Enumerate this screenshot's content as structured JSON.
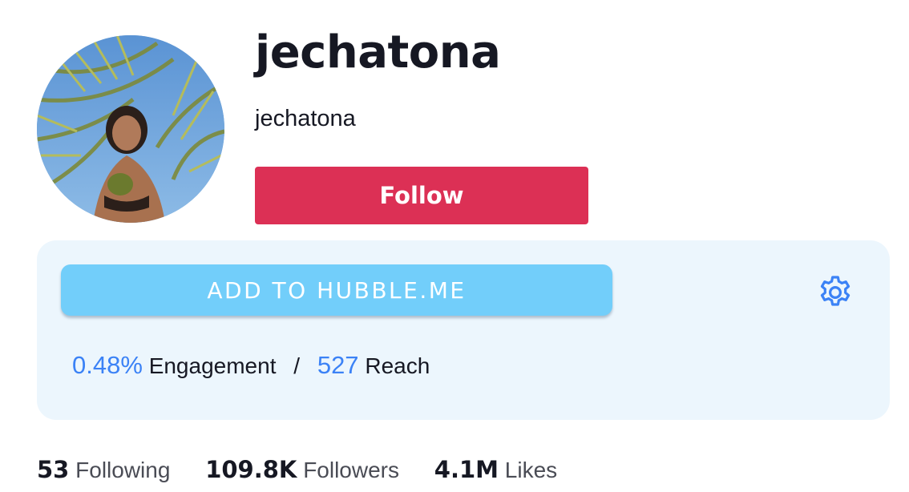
{
  "profile": {
    "display_name": "jechatona",
    "username": "jechatona",
    "follow_label": "Follow",
    "follow_color": "#dc3055",
    "avatar_icon": "profile-photo"
  },
  "hubble": {
    "add_label": "ADD TO HUBBLE.ME",
    "button_color": "#72cefa",
    "panel_color": "#ecf6fd",
    "settings_icon": "gear-icon",
    "engagement_value": "0.48%",
    "engagement_label": "Engagement",
    "separator": "/",
    "reach_value": "527",
    "reach_label": "Reach",
    "accent_color": "#3b82f6"
  },
  "stats": {
    "following_count": "53",
    "following_label": "Following",
    "followers_count": "109.8K",
    "followers_label": "Followers",
    "likes_count": "4.1M",
    "likes_label": "Likes"
  }
}
